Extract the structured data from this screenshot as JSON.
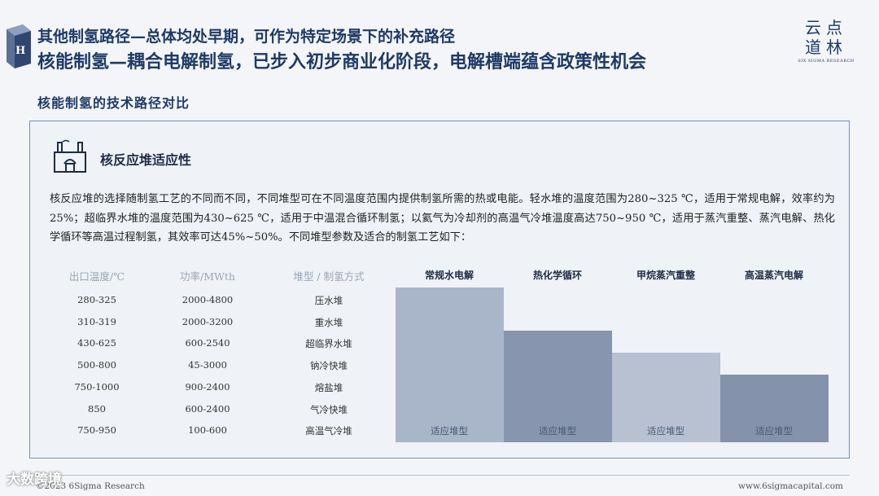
{
  "header": {
    "title_line1": "其他制氢路径—总体均处早期，可作为特定场景下的补充路径",
    "title_line2": "核能制氢—耦合电解制氢，已步入初步商业化阶段，电解槽端蕴含政策性机会",
    "icon_label": "H₂"
  },
  "logo": {
    "line1": "云点",
    "line2": "道林",
    "line3": "SIX SIGMA RESEARCH"
  },
  "subtitle": "核能制氢的技术路径对比",
  "section": {
    "title": "核反应堆适应性",
    "description": "核反应堆的选择随制氢工艺的不同而不同，不同堆型可在不同温度范围内提供制氢所需的热或电能。轻水堆的温度范围为280~325 ℃，适用于常规电解，效率约为25%；超临界水堆的温度范围为430~625 ℃，适用于中温混合循环制氢；以氦气为冷却剂的高温气冷堆温度高达750~950 ℃，适用于蒸汽重整、蒸汽电解、热化学循环等高温过程制氢，其效率可达45%~50%。不同堆型参数及适合的制氢工艺如下："
  },
  "table": {
    "headers": [
      "出口温度/℃",
      "功率/MWth",
      "堆型 / 制氢方式"
    ],
    "rows": [
      [
        "280-325",
        "2000-4800",
        "压水堆"
      ],
      [
        "310-319",
        "2000-3200",
        "重水堆"
      ],
      [
        "430-625",
        "600-2540",
        "超临界水堆"
      ],
      [
        "500-800",
        "45-3000",
        "钠冷快堆"
      ],
      [
        "750-1000",
        "900-2400",
        "熔盐堆"
      ],
      [
        "850",
        "600-2400",
        "气冷快堆"
      ],
      [
        "750-950",
        "100-600",
        "高温气冷堆"
      ]
    ]
  },
  "bars": {
    "headers": [
      "常规水电解",
      "热化学循环",
      "甲烷蒸汽重整",
      "高温蒸汽电解"
    ],
    "label": "适应堆型",
    "colors": [
      "#a9b6ca",
      "#8795ae",
      "#b7c1d2",
      "#8492ab"
    ],
    "rows_covered_from": [
      1,
      3,
      4,
      5
    ]
  },
  "footer": {
    "left": "©2023 6Sigma Research",
    "right": "www.6sigmacapital.com",
    "badge": "大数跨境"
  }
}
